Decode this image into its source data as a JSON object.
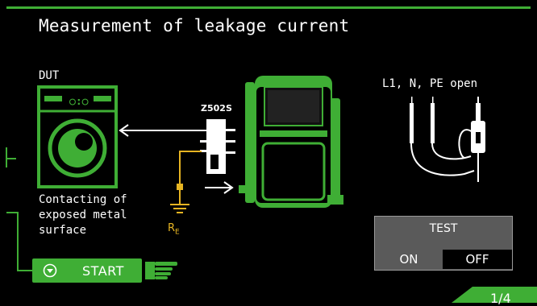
{
  "title": "Measurement of leakage current",
  "dut": {
    "label": "DUT",
    "description": "Contacting of\nexposed metal\nsurface",
    "display_text": "○:○"
  },
  "adapter_label": "Z502S",
  "re_label": {
    "main": "R",
    "sub": "E"
  },
  "probe_label": "L1, N, PE open",
  "test": {
    "title": "TEST",
    "on_label": "ON",
    "off_label": "OFF",
    "selected": "OFF"
  },
  "start_label": "START",
  "page_indicator": "1/4",
  "colors": {
    "accent": "#3fae35",
    "ground": "#e6b422",
    "panel": "#5a5a5a"
  }
}
